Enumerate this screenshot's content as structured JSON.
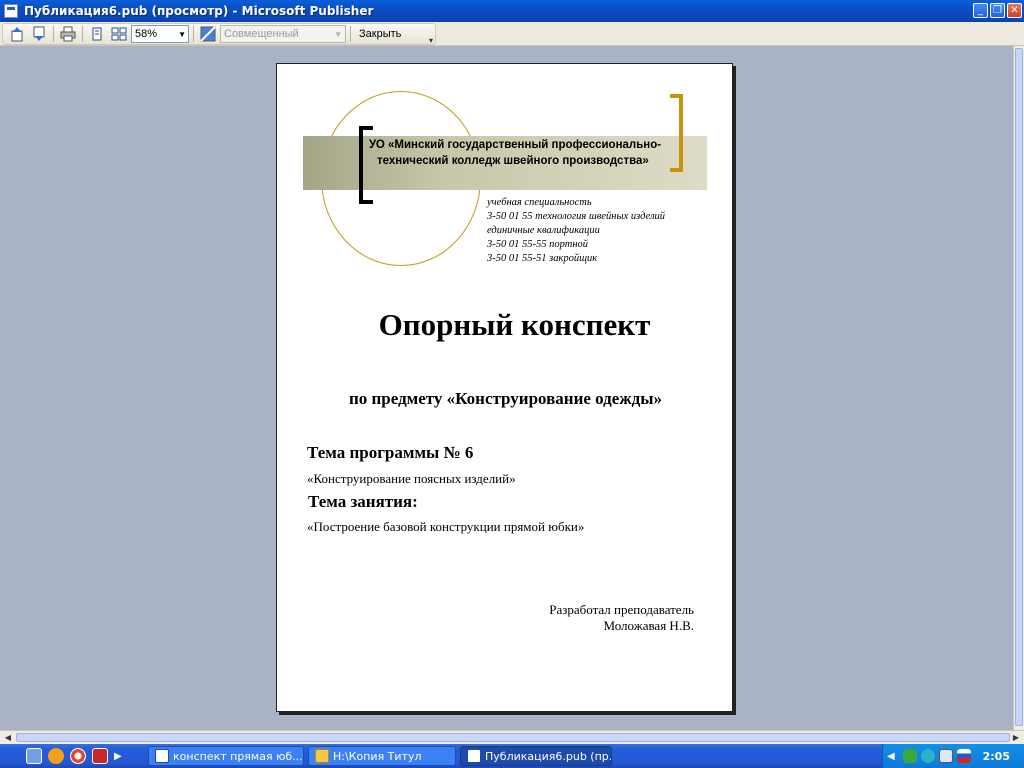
{
  "window": {
    "title": "Публикация6.pub (просмотр)  - Microsoft Publisher"
  },
  "toolbar": {
    "zoom_value": "58%",
    "mode_value": "Совмещенный",
    "close_label": "Закрыть"
  },
  "document": {
    "college_line1": "УО  «Минский государственный профессионально-",
    "college_line2": "технический колледж швейного производства»",
    "spec": [
      "учебная специальность",
      "3-50 01 55 технология швейных изделий",
      "единичные квалификации",
      "3-50 01 55-55 портной",
      "3-50 01 55-51 закройщик"
    ],
    "heading": "Опорный конспект",
    "subject": "по предмету «Конструирование одежды»",
    "theme_heading": "Тема программы № 6",
    "theme_text": "«Конструирование поясных изделий»",
    "lesson_heading": "Тема занятия:",
    "lesson_text": "«Построение базовой конструкции прямой юбки»",
    "author_line1": "Разработал преподаватель",
    "author_line2": "Моложавая Н.В."
  },
  "taskbar": {
    "tasks": [
      {
        "label": "конспект прямая юб..."
      },
      {
        "label": "H:\\Копия Титул"
      },
      {
        "label": "Публикация6.pub (пр..."
      }
    ],
    "clock": "2:05"
  },
  "colors": {
    "workspace_bg": "#a9b3c5",
    "accent_gold": "#c9940d",
    "title_blue": "#0a4fc8"
  }
}
